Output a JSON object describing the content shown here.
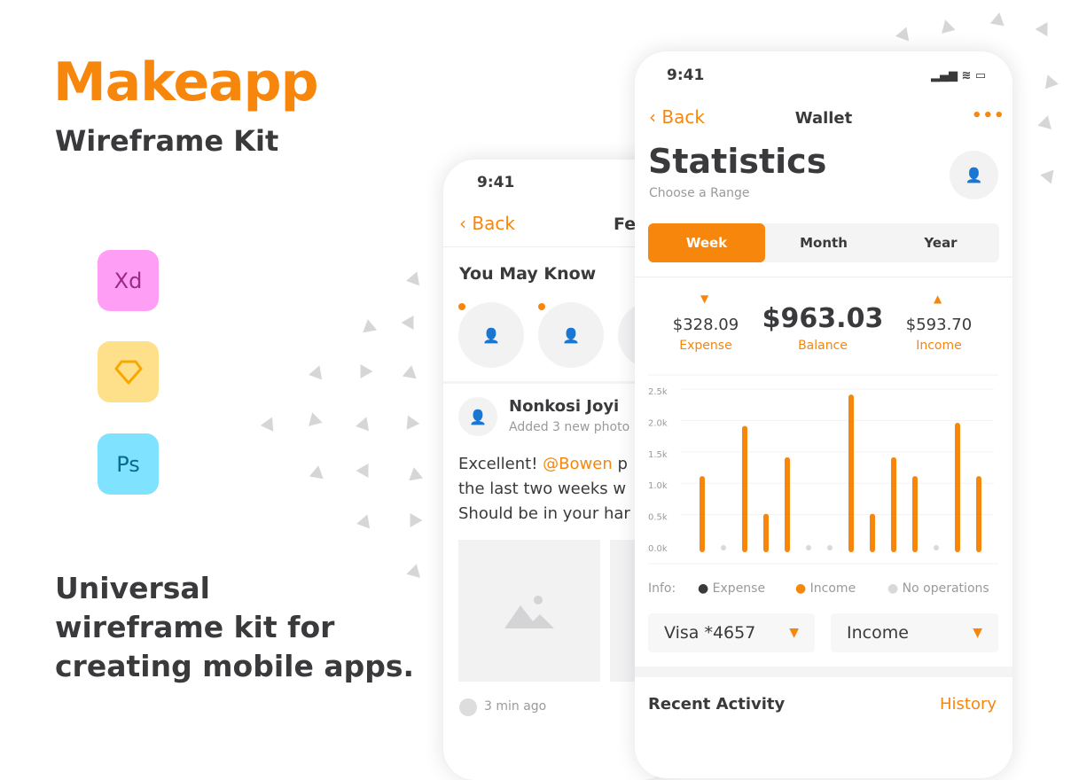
{
  "promo": {
    "brand": "Makeapp",
    "subtitle": "Wireframe Kit",
    "tagline": [
      "Universal",
      "wireframe kit for",
      "creating mobile apps."
    ],
    "apps": [
      {
        "label": "Xd",
        "color": "#ff9ef5",
        "text": "#9b2a8a"
      },
      {
        "label": "sketch",
        "color": "#ffe08a",
        "text": "#f7a800"
      },
      {
        "label": "Ps",
        "color": "#7fe3ff",
        "text": "#0a6a8a"
      }
    ]
  },
  "accent": "#f7860c",
  "feed": {
    "time": "9:41",
    "back": "Back",
    "title": "Fe",
    "section": "You May Know",
    "post": {
      "author": "Nonkosi Joyi",
      "action": "Added 3 new photo",
      "text_before": "Excellent! ",
      "mention": "@Bowen",
      "text_after": " p",
      "line2": "the last two weeks w",
      "line3": "Should be in your har",
      "timestamp": "3 min ago"
    }
  },
  "wallet": {
    "time": "9:41",
    "back": "Back",
    "title": "Wallet",
    "more": "•••",
    "heading": "Statistics",
    "subheading": "Choose a Range",
    "tabs": [
      "Week",
      "Month",
      "Year"
    ],
    "active_tab": "Week",
    "expense": {
      "value": "$328.09",
      "label": "Expense"
    },
    "balance": {
      "value": "$963.03",
      "label": "Balance"
    },
    "income": {
      "value": "$593.70",
      "label": "Income"
    },
    "legend": {
      "title": "Info:",
      "items": [
        {
          "label": "Expense",
          "color": "#3a3a3c"
        },
        {
          "label": "Income",
          "color": "#f7860c"
        },
        {
          "label": "No operations",
          "color": "#d9d9dc"
        }
      ]
    },
    "card_select": "Visa *4657",
    "type_select": "Income",
    "recent": "Recent Activity",
    "history": "History"
  },
  "chart_data": {
    "type": "bar",
    "yticks": [
      "0.0k",
      "0.5k",
      "1.0k",
      "1.5k",
      "2.0k",
      "2.5k"
    ],
    "ylim": [
      0,
      2500
    ],
    "values": [
      1100,
      0,
      1900,
      500,
      1400,
      0,
      0,
      2400,
      500,
      1400,
      1100,
      0,
      1950,
      1100
    ]
  }
}
